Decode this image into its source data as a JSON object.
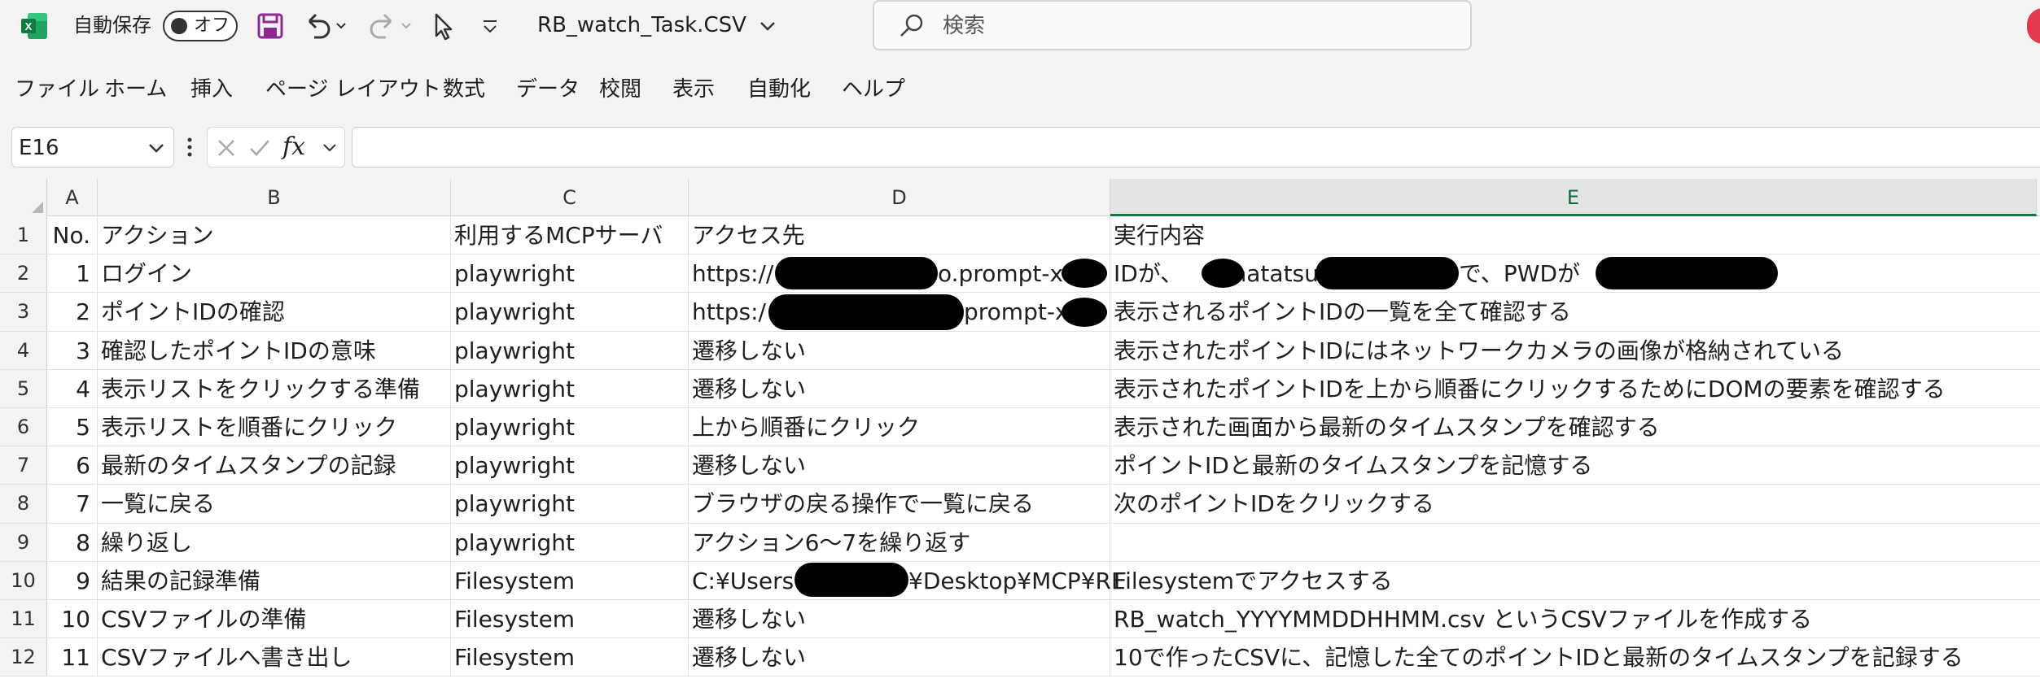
{
  "titlebar": {
    "autosave_label": "自動保存",
    "toggle_state": "オフ",
    "file_name": "RB_watch_Task.CSV",
    "search_placeholder": "検索"
  },
  "ribbon": {
    "tabs": [
      "ファイル",
      "ホーム",
      "挿入",
      "ページ レイアウト",
      "数式",
      "データ",
      "校閲",
      "表示",
      "自動化",
      "ヘルプ"
    ]
  },
  "formula_bar": {
    "cell_ref": "E16",
    "fx": "fx",
    "value": ""
  },
  "grid": {
    "columns": [
      "A",
      "B",
      "C",
      "D",
      "E"
    ],
    "selected_column": "E",
    "rows": [
      {
        "n": "1",
        "a": "No.",
        "b": "アクション",
        "c": "利用するMCPサーバ",
        "d": "アクセス先",
        "e": "実行内容"
      },
      {
        "n": "2",
        "a": "1",
        "b": "ログイン",
        "c": "playwright",
        "d": "https://",
        "d2": "o.prompt-x",
        "e": "IDが、",
        "e2": "matatsu@",
        "e3": "で、PWDが"
      },
      {
        "n": "3",
        "a": "2",
        "b": "ポイントIDの確認",
        "c": "playwright",
        "d": "https:/",
        "d2": "prompt-x",
        "e": "表示されるポイントIDの一覧を全て確認する"
      },
      {
        "n": "4",
        "a": "3",
        "b": "確認したポイントIDの意味",
        "c": "playwright",
        "d": "遷移しない",
        "e": "表示されたポイントIDにはネットワークカメラの画像が格納されている"
      },
      {
        "n": "5",
        "a": "4",
        "b": "表示リストをクリックする準備",
        "c": "playwright",
        "d": "遷移しない",
        "e": "表示されたポイントIDを上から順番にクリックするためにDOMの要素を確認する"
      },
      {
        "n": "6",
        "a": "5",
        "b": "表示リストを順番にクリック",
        "c": "playwright",
        "d": "上から順番にクリック",
        "e": "表示された画面から最新のタイムスタンプを確認する"
      },
      {
        "n": "7",
        "a": "6",
        "b": "最新のタイムスタンプの記録",
        "c": "playwright",
        "d": "遷移しない",
        "e": "ポイントIDと最新のタイムスタンプを記憶する"
      },
      {
        "n": "8",
        "a": "7",
        "b": "一覧に戻る",
        "c": "playwright",
        "d": "ブラウザの戻る操作で一覧に戻る",
        "e": "次のポイントIDをクリックする"
      },
      {
        "n": "9",
        "a": "8",
        "b": "繰り返し",
        "c": "playwright",
        "d": "アクション6〜7を繰り返す",
        "e": ""
      },
      {
        "n": "10",
        "a": "9",
        "b": "結果の記録準備",
        "c": "Filesystem",
        "d": "C:¥Users",
        "d2": "¥Desktop¥MCP¥RE",
        "e": "Filesystemでアクセスする"
      },
      {
        "n": "11",
        "a": "10",
        "b": "CSVファイルの準備",
        "c": "Filesystem",
        "d": "遷移しない",
        "e": "RB_watch_YYYYMMDDHHMM.csv というCSVファイルを作成する"
      },
      {
        "n": "12",
        "a": "11",
        "b": "CSVファイルへ書き出し",
        "c": "Filesystem",
        "d": "遷移しない",
        "e": "10で作ったCSVに、記憶した全てのポイントIDと最新のタイムスタンプを記録する"
      }
    ]
  },
  "colors": {
    "excel_green": "#107c41",
    "save_purple": "#8e2a8f",
    "redaction": "#000000"
  }
}
